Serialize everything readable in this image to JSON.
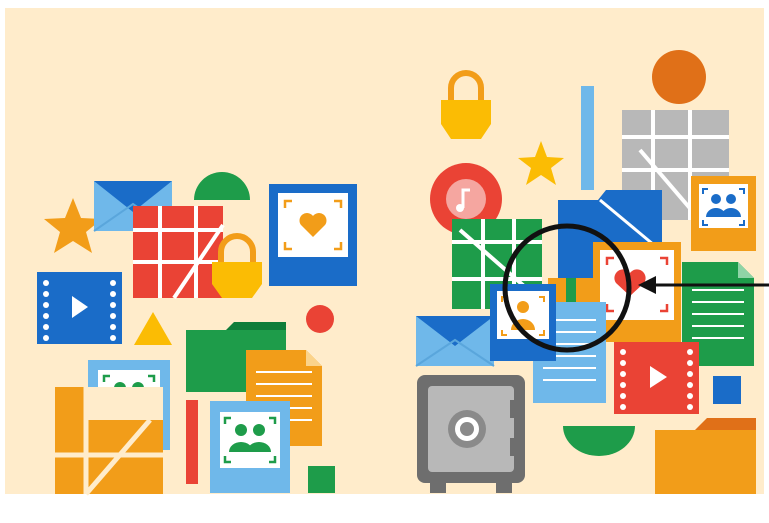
{
  "colors": {
    "background": "#ffeccb",
    "frame": "#ffffff",
    "blue_dark": "#1a6cc8",
    "blue_light": "#6fb8ea",
    "red": "#ea4335",
    "green": "#1e9c4a",
    "yellow": "#fbbc04",
    "orange": "#f29d19",
    "orange_dark": "#e08a1a",
    "grey": "#b8b8b8",
    "grey_dark": "#6e6e6e",
    "black": "#111111"
  },
  "left_cluster": {
    "icons": [
      "star-icon",
      "envelope-icon",
      "half-circle-icon",
      "grid-tile-icon",
      "heart-photo-icon",
      "padlock-icon",
      "video-icon",
      "triangle-icon",
      "dot-icon",
      "folder-icon",
      "document-icon",
      "people-photo-icon",
      "bar-icon",
      "square-icon"
    ]
  },
  "right_cluster": {
    "icons": [
      "padlock-icon",
      "circle-icon",
      "bar-icon",
      "grid-tile-icon",
      "music-note-icon",
      "star-icon",
      "folder-icon",
      "people-photo-icon",
      "heart-photo-icon",
      "person-photo-icon",
      "envelope-icon",
      "document-icon",
      "video-icon",
      "safe-icon",
      "half-circle-icon",
      "square-icon"
    ],
    "highlight": "magnifier-circle-icon",
    "pointer": "arrow-icon"
  }
}
